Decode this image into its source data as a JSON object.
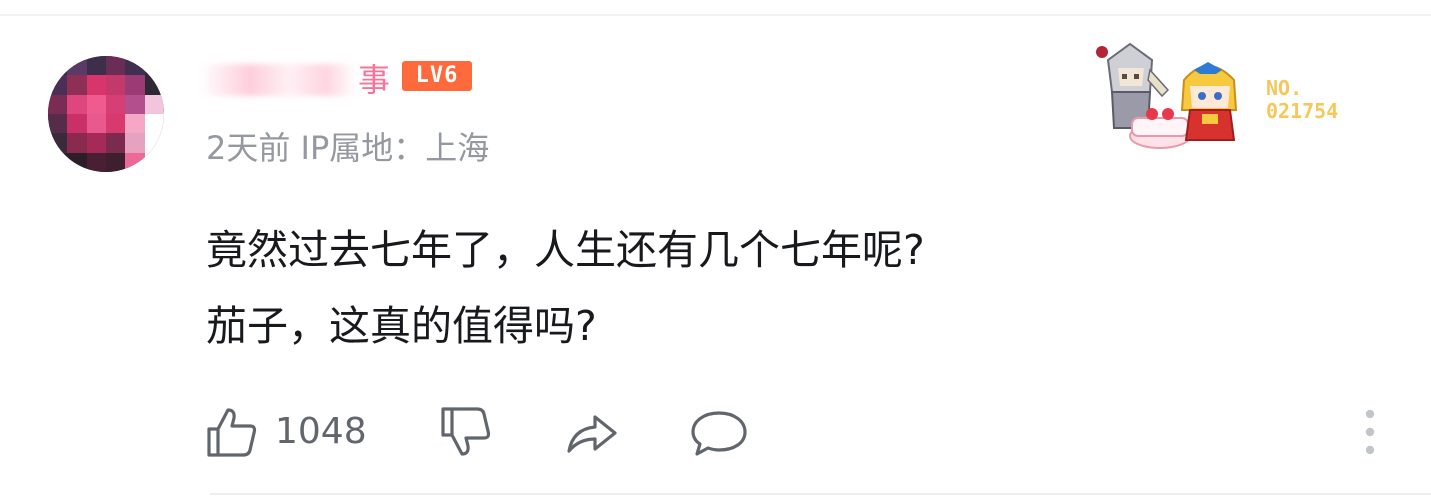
{
  "user": {
    "name_visible": "事",
    "level": "LV6"
  },
  "meta": {
    "time": "2天前",
    "ip_location": "IP属地：上海"
  },
  "comment": {
    "text": "竟然过去七年了，人生还有几个七年呢?\n茄子，这真的值得吗?"
  },
  "fan_badge": {
    "label": "NO.",
    "number": "021754"
  },
  "actions": {
    "like_count": "1048"
  },
  "colors": {
    "username": "#fb7299",
    "level_badge": "#ff6a3d",
    "meta_text": "#9499a0",
    "comment_text": "#18191c",
    "fan_number": "#f6c85a",
    "icon": "#61666d"
  }
}
